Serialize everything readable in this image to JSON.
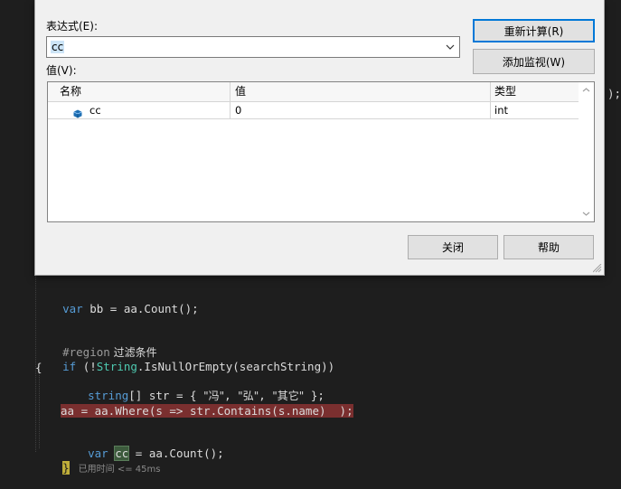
{
  "dialog": {
    "expression_label": "表达式(E):",
    "expression_value": "cc",
    "value_label": "值(V):",
    "recalculate_button": "重新计算(R)",
    "add_watch_button": "添加监视(W)",
    "close_button": "关闭",
    "help_button": "帮助",
    "columns": {
      "name": "名称",
      "value": "值",
      "type": "类型"
    },
    "rows": [
      {
        "name": "cc",
        "value": "0",
        "type": "int"
      }
    ]
  },
  "code": {
    "line_bb": {
      "kw": "var",
      "rest1": " bb = aa.",
      "method": "Count",
      "rest2": "();"
    },
    "line_region": {
      "pp": "#region",
      "zh": " 过滤条件"
    },
    "line_if": {
      "kw": "if",
      "rest1": " (!",
      "type": "String",
      "rest2": ".IsNullOrEmpty(searchString))"
    },
    "line_brace_open": "{",
    "line_arr": {
      "type": "string",
      "rest1": "[] str = { ",
      "s1": "\"冯\"",
      "c1": ", ",
      "s2": "\"弘\"",
      "c2": ", ",
      "s3": "\"其它\"",
      "rest2": " };"
    },
    "line_where": "aa = aa.Where(s => str.Contains(s.name)  );",
    "line_cc": {
      "kw": "var",
      "sp": " ",
      "name": "cc",
      "rest": " = aa.Count();"
    },
    "line_brace_close": "}",
    "elapsed": "已用时间 <= 45ms",
    "trail_semicolon": ");"
  },
  "colors": {
    "keyword": "#569cd6",
    "type": "#4ec9b0",
    "string": "#d69d85",
    "error_highlight": "#7a2f2f",
    "dialog_bg": "#f0f0f0",
    "focus_border": "#0078d7"
  }
}
